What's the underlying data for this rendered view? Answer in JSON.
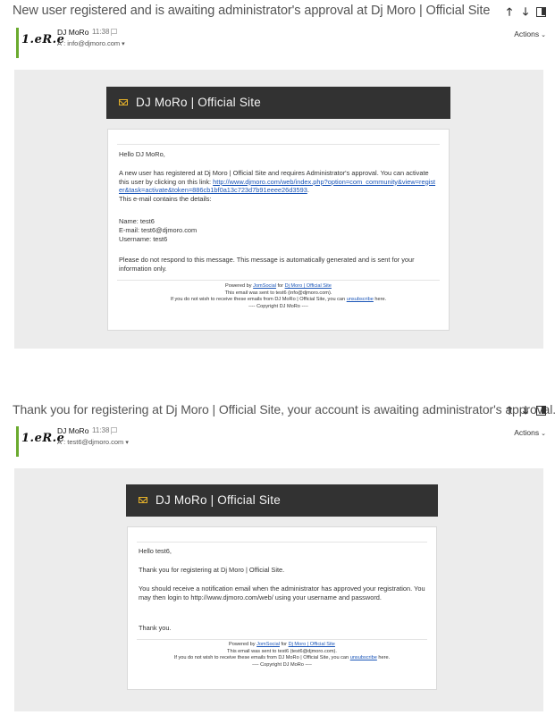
{
  "email1": {
    "subject": "New user registered and is awaiting administrator's approval at Dj Moro | Official Site",
    "logo_text": "1.eR.e",
    "sender": "DJ MoRo",
    "time": "11:38",
    "recipient": "À : info@djmoro.com",
    "actions_label": "Actions",
    "site_title": "DJ MoRo | Official Site",
    "greeting": "Hello DJ MoRo,",
    "para1_text": "A new user has registered at Dj Moro | Official Site and requires Administrator's approval. You can activate this user by clicking on this link: ",
    "activation_link": "http://www.djmoro.com/web/index.php?option=com_community&view=register&task=activate&token=886cb1bf0a13c723d7b91eeee26d3593",
    "para1_suffix": ".",
    "para1_line2": "This e-mail contains the details:",
    "detail_name": "Name: test6",
    "detail_email": "E-mail: test6@djmoro.com",
    "detail_username": "Username: test6",
    "notice": "Please do not respond to this message. This message is automatically generated and is sent for your information only.",
    "powered_by": "Powered by ",
    "powered_link": "JomSocial",
    "powered_for": " for ",
    "site_link": "Dj Moro | Official Site",
    "sent_to": "This email was sent to test6 (info@djmoro.com).",
    "unsub_prefix": "If you do not wish to receive these emails from DJ MoRo | Official Site, you can ",
    "unsub_link": "unsubscribe",
    "unsub_suffix": " here.",
    "copyright": "---- Copyright DJ MoRo ----"
  },
  "email2": {
    "subject": "Thank you for registering at Dj Moro | Official Site, your account is awaiting administrator's approval.",
    "logo_text": "1.eR.e",
    "sender": "DJ MoRo",
    "time": "11:38",
    "recipient": "À : test6@djmoro.com",
    "actions_label": "Actions",
    "site_title": "DJ MoRo | Official Site",
    "greeting": "Hello test6,",
    "line1": "Thank you for registering at Dj Moro | Official Site.",
    "line2": "You should receive a notification email when the administrator has approved your registration. You may then login to http://www.djmoro.com/web/ using your username and password.",
    "line3": "Thank you.",
    "powered_by": "Powered by ",
    "powered_link": "JomSocial",
    "powered_for": " for ",
    "site_link": "Dj Moro | Official Site",
    "sent_to": "This email was sent to test6 (test6@djmoro.com).",
    "unsub_prefix": "If you do not wish to receive these emails from DJ MoRo | Official Site, you can ",
    "unsub_link": "unsubscribe",
    "unsub_suffix": " here.",
    "copyright": "---- Copyright DJ MoRo ----"
  },
  "icons": [
    "arrow-up-icon",
    "arrow-down-icon",
    "popout-icon",
    "flag-icon",
    "mail-icon",
    "chevron-down-icon"
  ],
  "colors": {
    "accent": "#6aaa2e",
    "banner": "#323232",
    "mail_icon": "#e5b12a",
    "link": "#1a55b8",
    "panel": "#ececec"
  }
}
